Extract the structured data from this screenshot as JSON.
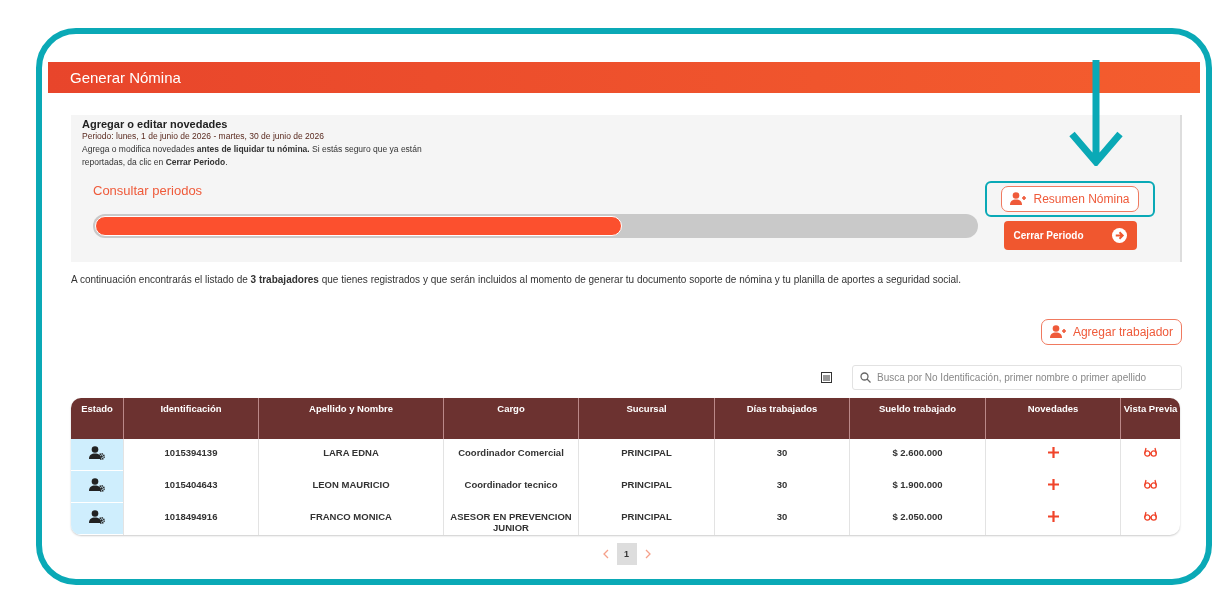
{
  "header": {
    "title": "Generar Nómina"
  },
  "period_panel": {
    "title": "Agregar o editar novedades",
    "period": "Periodo: lunes, 1 de junio de 2026 - martes, 30 de junio de 2026",
    "note": "Agrega o modifica novedades **antes de liquidar tu nómina.** Si estás seguro que ya están reportadas, da clic en **Cerrar Periodo**.",
    "link": "Consultar periodos",
    "progress": {
      "level": 0.6
    },
    "summary_button": "Resumen Nómina",
    "close_button": "Cerrar Periodo"
  },
  "intro": "A continuación encontrarás el listado de **3 trabajadores** que tienes registrados y que serán incluidos al momento de generar tu documento soporte de nómina y tu planilla de aportes a seguridad social.",
  "add_button": "Agregar trabajador",
  "search": {
    "placeholder": "Busca por No Identificación, primer nombre o primer apellido"
  },
  "table": {
    "columns": [
      "Estado",
      "Identificación",
      "Apellido y Nombre",
      "Cargo",
      "Sucursal",
      "Días trabajados",
      "Sueldo trabajado",
      "Novedades",
      "Vista Previa"
    ],
    "rows": [
      {
        "id": "1015394139",
        "name": "LARA EDNA",
        "role": "Coordinador Comercial",
        "branch": "PRINCIPAL",
        "days": "30",
        "salary": "$ 2.600.000"
      },
      {
        "id": "1015404643",
        "name": "LEON MAURICIO",
        "role": "Coordinador tecnico",
        "branch": "PRINCIPAL",
        "days": "30",
        "salary": "$ 1.900.000"
      },
      {
        "id": "1018494916",
        "name": "FRANCO MONICA",
        "role": "ASESOR EN PREVENCION JUNIOR",
        "branch": "PRINCIPAL",
        "days": "30",
        "salary": "$ 2.050.000"
      }
    ]
  },
  "pagination": {
    "pages": [
      {
        "label": "1",
        "selected": true
      }
    ]
  }
}
